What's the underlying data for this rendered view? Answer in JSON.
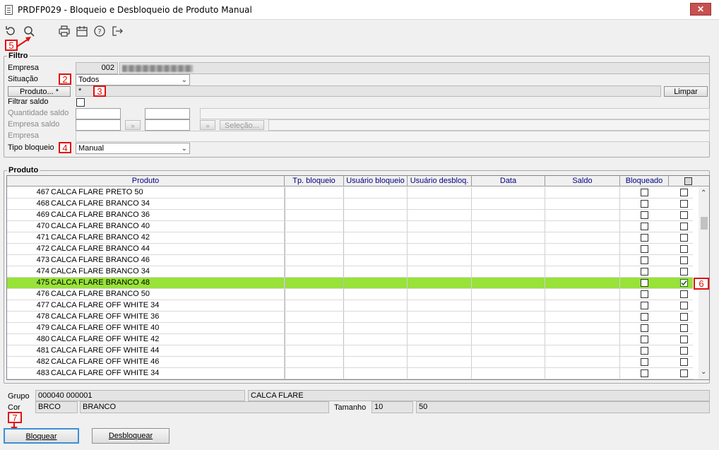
{
  "window": {
    "title": "PRDFP029 - Bloqueio e Desbloqueio de Produto Manual",
    "close_glyph": "✕"
  },
  "toolbar": {
    "icons": [
      "refresh-icon",
      "search-icon",
      "print-icon",
      "calendar-icon",
      "help-icon",
      "exit-icon"
    ]
  },
  "markers": {
    "m2": "2",
    "m3": "3",
    "m4": "4",
    "m5": "5",
    "m6": "6",
    "m7": "7"
  },
  "filtro": {
    "legend": "Filtro",
    "empresa_label": "Empresa",
    "empresa_code": "002",
    "situacao_label": "Situação",
    "situacao_value": "Todos",
    "produto_button": "Produto... *",
    "produto_value": "*",
    "limpar_button": "Limpar",
    "filtrar_saldo_label": "Filtrar saldo",
    "quantidade_saldo_label": "Quantidade saldo",
    "empresa_saldo_label": "Empresa saldo",
    "selecao_button": "Seleção...",
    "empresa2_label": "Empresa",
    "tipo_bloqueio_label": "Tipo bloqueio",
    "tipo_bloqueio_value": "Manual"
  },
  "produto": {
    "legend": "Produto",
    "columns": [
      "Produto",
      "Tp. bloqueio",
      "Usuário bloqueio",
      "Usuário desbloq.",
      "Data",
      "Saldo",
      "Bloqueado"
    ],
    "rows": [
      {
        "code": "467",
        "name": "CALCA FLARE PRETO 50",
        "checked": false
      },
      {
        "code": "468",
        "name": "CALCA FLARE BRANCO 34",
        "checked": false
      },
      {
        "code": "469",
        "name": "CALCA FLARE BRANCO 36",
        "checked": false
      },
      {
        "code": "470",
        "name": "CALCA FLARE BRANCO 40",
        "checked": false
      },
      {
        "code": "471",
        "name": "CALCA FLARE BRANCO 42",
        "checked": false
      },
      {
        "code": "472",
        "name": "CALCA FLARE BRANCO 44",
        "checked": false
      },
      {
        "code": "473",
        "name": "CALCA FLARE BRANCO 46",
        "checked": false
      },
      {
        "code": "474",
        "name": "CALCA FLARE BRANCO 34",
        "checked": false
      },
      {
        "code": "475",
        "name": "CALCA FLARE BRANCO 48",
        "checked": true,
        "selected": true
      },
      {
        "code": "476",
        "name": "CALCA FLARE BRANCO 50",
        "checked": false
      },
      {
        "code": "477",
        "name": "CALCA FLARE OFF WHITE 34",
        "checked": false
      },
      {
        "code": "478",
        "name": "CALCA FLARE OFF WHITE 36",
        "checked": false
      },
      {
        "code": "479",
        "name": "CALCA FLARE OFF WHITE 40",
        "checked": false
      },
      {
        "code": "480",
        "name": "CALCA FLARE OFF WHITE 42",
        "checked": false
      },
      {
        "code": "481",
        "name": "CALCA FLARE OFF WHITE 44",
        "checked": false
      },
      {
        "code": "482",
        "name": "CALCA FLARE OFF WHITE 46",
        "checked": false
      },
      {
        "code": "483",
        "name": "CALCA FLARE OFF WHITE 34",
        "checked": false
      }
    ],
    "selected_color": "#98e23a"
  },
  "detail": {
    "grupo_label": "Grupo",
    "grupo_code": "000040 000001",
    "grupo_desc": "CALCA FLARE",
    "cor_label": "Cor",
    "cor_code": "BRCO",
    "cor_desc": "BRANCO",
    "tamanho_label": "Tamanho",
    "tamanho_code": "10",
    "tamanho_desc": "50"
  },
  "actions": {
    "bloquear": "Bloquear",
    "desbloquear": "Desbloquear"
  },
  "colors": {
    "marker_red": "#e01010"
  }
}
